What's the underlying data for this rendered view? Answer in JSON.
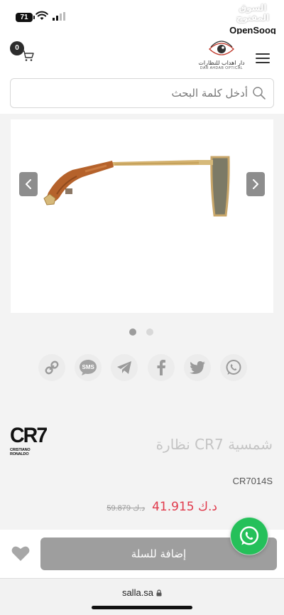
{
  "status_bar": {
    "battery": "71",
    "watermark_ar": "السوق المفتوح",
    "watermark_en": "OpenSooq"
  },
  "header": {
    "cart_count": "0",
    "logo_ar": "دار اهداب للنظارات",
    "logo_en": "DAR AHDAB OPTICAL"
  },
  "search": {
    "placeholder": "أدخل كلمة البحث"
  },
  "gallery": {
    "slide_count": 2,
    "active_slide": 1
  },
  "share": {
    "items": [
      "link-icon",
      "sms-icon",
      "telegram-icon",
      "facebook-icon",
      "twitter-icon",
      "whatsapp-icon"
    ],
    "sms_label": "SMS"
  },
  "product": {
    "brand_main": "CR7",
    "brand_sub": "CRISTIANO RONALDO",
    "title": "نظارة CR7 شمسية",
    "sku": "CR7014S",
    "price_old": "59.879 د.ك",
    "price_new": "41.915 د.ك",
    "price_color": "#e0394b"
  },
  "actions": {
    "add_to_cart": "إضافة للسلة",
    "favorite_icon": "heart-icon",
    "whatsapp_fab_icon": "whatsapp-icon",
    "whatsapp_color": "#25c05a"
  },
  "browser": {
    "url": "salla.sa"
  }
}
